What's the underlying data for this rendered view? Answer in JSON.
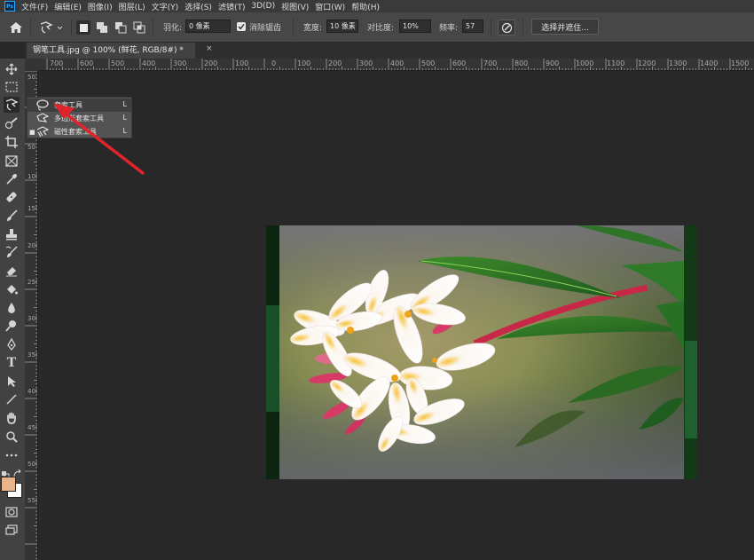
{
  "app": {
    "logo": "Ps"
  },
  "menu": {
    "items": [
      "文件(F)",
      "编辑(E)",
      "图像(I)",
      "图层(L)",
      "文字(Y)",
      "选择(S)",
      "滤镜(T)",
      "3D(D)",
      "视图(V)",
      "窗口(W)",
      "帮助(H)"
    ]
  },
  "options": {
    "feather_label": "羽化:",
    "feather_value": "0 像素",
    "antialias_label": "消除锯齿",
    "width_label": "宽度:",
    "width_value": "10 像素",
    "contrast_label": "对比度:",
    "contrast_value": "10%",
    "frequency_label": "频率:",
    "frequency_value": "57",
    "select_mask_label": "选择并遮住..."
  },
  "document": {
    "tab_title": "钢笔工具.jpg @ 100% (鲜花, RGB/8#) *",
    "close": "×"
  },
  "ruler": {
    "top_labels": [
      "700",
      "600",
      "500",
      "400",
      "300",
      "200",
      "100",
      "0",
      "100",
      "200",
      "300",
      "400",
      "500",
      "600",
      "700",
      "800",
      "900",
      "1000",
      "1100",
      "1200",
      "1300",
      "1400",
      "1500"
    ],
    "left_labels": [
      "50",
      "0",
      "50",
      "100",
      "150",
      "200",
      "250",
      "300",
      "350",
      "400",
      "450",
      "500",
      "550"
    ]
  },
  "flyout": {
    "items": [
      {
        "label": "套索工具",
        "key": "L",
        "icon": "lasso-icon",
        "active": true
      },
      {
        "label": "多边形套索工具",
        "key": "L",
        "icon": "polygonal-lasso-icon",
        "active": false
      },
      {
        "label": "磁性套索工具",
        "key": "L",
        "icon": "magnetic-lasso-icon",
        "active": false
      }
    ]
  },
  "colors": {
    "foreground": "#e8b48a",
    "background": "#ffffff",
    "accent": "#31a8ff",
    "arrow": "#e0242b"
  },
  "tools": [
    "move-icon",
    "marquee-icon",
    "lasso-icon",
    "quick-select-icon",
    "crop-icon",
    "frame-icon",
    "eyedropper-icon",
    "healing-icon",
    "brush-icon",
    "stamp-icon",
    "history-brush-icon",
    "eraser-icon",
    "paint-bucket-icon",
    "blur-icon",
    "dodge-icon",
    "pen-icon",
    "type-icon",
    "path-select-icon",
    "line-icon",
    "hand-icon",
    "zoom-icon",
    "more-icon"
  ]
}
